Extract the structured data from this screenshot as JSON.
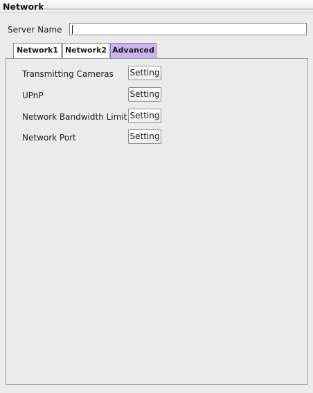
{
  "window": {
    "title": "Network"
  },
  "server": {
    "label": "Server Name",
    "value": ""
  },
  "tabs": [
    {
      "label": "Network1",
      "active": false
    },
    {
      "label": "Network2",
      "active": false
    },
    {
      "label": "Advanced",
      "active": true
    }
  ],
  "advanced": {
    "rows": [
      {
        "label": "Transmitting Cameras",
        "button": "Setting"
      },
      {
        "label": "UPnP",
        "button": "Setting"
      },
      {
        "label": "Network Bandwidth Limit",
        "button": "Setting"
      },
      {
        "label": "Network Port",
        "button": "Setting"
      }
    ]
  },
  "colors": {
    "active_tab": "#c9b6ef",
    "background": "#ebebeb"
  }
}
